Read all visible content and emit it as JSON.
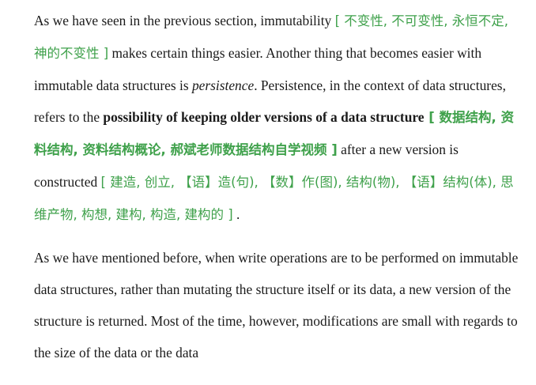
{
  "paragraph1": {
    "t1": "As we have seen in the previous section, immutability ",
    "a1": "[ 不变性, 不可变性, 永恒不定, 神的不变性 ]",
    "t2": " makes certain things easier. Another thing that becomes easier with immutable data structures is ",
    "t3": "persistence",
    "t4": ". Persistence, in the context of data structures, refers to the ",
    "t5": "possibility of keeping older versions of a data structure",
    "a2": " [ 数据结构, 资料结构, 资料结构概论, 郝斌老师数据结构自学视频 ]",
    "t6": " after a new version is constructed ",
    "a3": "[ 建造, 创立, 【语】造(句), 【数】作(图), 结构(物), 【语】结构(体), 思维产物, 构想, 建构, 构造, 建构的 ]",
    "t7": " ."
  },
  "paragraph2": {
    "text": "As we have mentioned before, when write operations are to be performed on immutable data structures, rather than mutating the structure itself or its data, a new version of the structure is returned. Most of the time, however, modifications are small with regards to the size of the data or the data"
  },
  "colors": {
    "annotation": "#3fa14b",
    "text": "#1a1a1a"
  }
}
